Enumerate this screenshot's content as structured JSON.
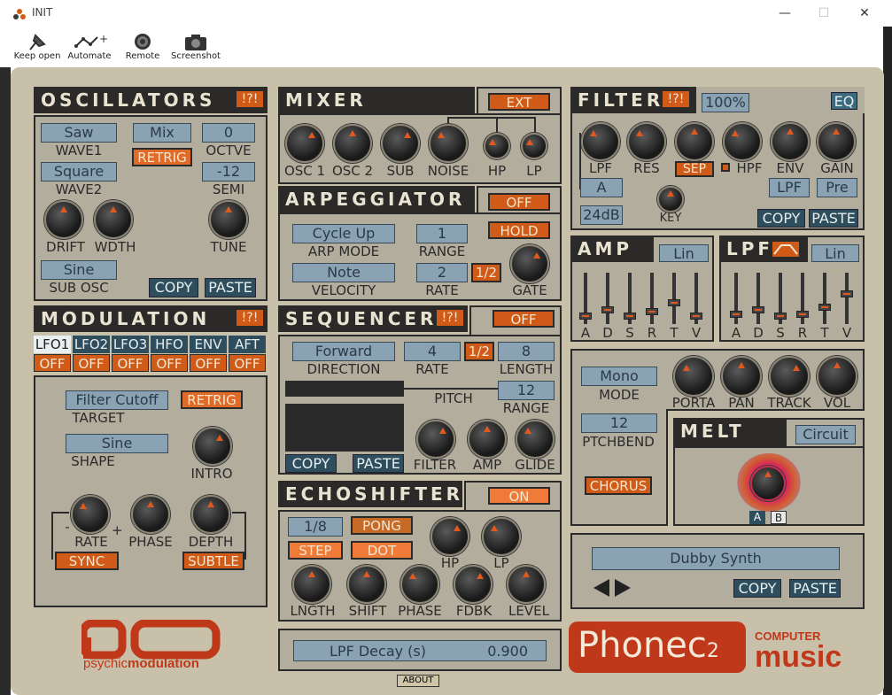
{
  "window": {
    "title": "INIT",
    "minimize": "—",
    "maximize": "☐",
    "close": "✕"
  },
  "toolbar": {
    "keep_open": "Keep open",
    "automate": "Automate",
    "remote": "Remote",
    "screenshot": "Screenshot"
  },
  "osc": {
    "title": "OSCILLATORS",
    "mark": "!?!",
    "wave1_val": "Saw",
    "wave1_lbl": "WAVE1",
    "mix": "Mix",
    "octve_val": "0",
    "octve_lbl": "OCTVE",
    "retrig": "RETRIG",
    "wave2_val": "Square",
    "wave2_lbl": "WAVE2",
    "semi_val": "-12",
    "semi_lbl": "SEMI",
    "drift": "DRIFT",
    "wdth": "WDTH",
    "tune": "TUNE",
    "sub_val": "Sine",
    "sub_lbl": "SUB OSC",
    "copy": "COPY",
    "paste": "PASTE"
  },
  "mixer": {
    "title": "MIXER",
    "ext": "EXT",
    "osc1": "OSC 1",
    "osc2": "OSC 2",
    "sub": "SUB",
    "noise": "NOISE",
    "hp": "HP",
    "lp": "LP"
  },
  "arp": {
    "title": "ARPEGGIATOR",
    "off": "OFF",
    "hold": "HOLD",
    "mode_val": "Cycle Up",
    "mode_lbl": "ARP MODE",
    "range_val": "1",
    "range_lbl": "RANGE",
    "vel_val": "Note",
    "vel_lbl": "VELOCITY",
    "rate_val": "2",
    "rate_lbl": "RATE",
    "half": "1/2",
    "gate": "GATE"
  },
  "seq": {
    "title": "SEQUENCER",
    "mark": "!?!",
    "off": "OFF",
    "dir_val": "Forward",
    "dir_lbl": "DIRECTION",
    "rate_val": "4",
    "rate_lbl": "RATE",
    "half": "1/2",
    "len_val": "8",
    "len_lbl": "LENGTH",
    "pitch": "PITCH",
    "range_val": "12",
    "range_lbl": "RANGE",
    "filter": "FILTER",
    "amp": "AMP",
    "glide": "GLIDE",
    "copy": "COPY",
    "paste": "PASTE"
  },
  "echo": {
    "title": "ECHOSHIFTER",
    "on": "ON",
    "time_val": "1/8",
    "pong": "PONG",
    "step": "STEP",
    "dot": "DOT",
    "hp": "HP",
    "lp": "LP",
    "lngth": "LNGTH",
    "shift": "SHIFT",
    "phase": "PHASE",
    "fdbk": "FDBK",
    "level": "LEVEL"
  },
  "filter": {
    "title": "FILTER",
    "mark": "!?!",
    "pct": "100%",
    "eq": "EQ",
    "lpf": "LPF",
    "res": "RES",
    "sep": "SEP",
    "hpf": "HPF",
    "env": "ENV",
    "gain": "GAIN",
    "a": "A",
    "slope": "24dB",
    "key": "KEY",
    "lpf_btn": "LPF",
    "pre": "Pre",
    "copy": "COPY",
    "paste": "PASTE"
  },
  "amp": {
    "title": "AMP",
    "curve": "Lin",
    "faders": [
      "A",
      "D",
      "S",
      "R",
      "T",
      "V"
    ],
    "levels": [
      0.1,
      0.25,
      0.1,
      0.2,
      0.4,
      0.1
    ]
  },
  "lpfenv": {
    "title": "LPF",
    "curve": "Lin",
    "faders": [
      "A",
      "D",
      "S",
      "R",
      "T",
      "V"
    ],
    "levels": [
      0.15,
      0.25,
      0.1,
      0.15,
      0.3,
      0.6
    ]
  },
  "voice": {
    "mode_val": "Mono",
    "mode_lbl": "MODE",
    "bend_val": "12",
    "bend_lbl": "PTCHBEND",
    "chorus": "CHORUS",
    "porta": "PORTA",
    "pan": "PAN",
    "track": "TRACK",
    "vol": "VOL"
  },
  "melt": {
    "title": "MELT",
    "type": "Circuit",
    "a": "A",
    "b": "B"
  },
  "preset": {
    "name": "Dubby Synth",
    "copy": "COPY",
    "paste": "PASTE"
  },
  "mod": {
    "title": "MODULATION",
    "mark": "!?!",
    "tabs": [
      "LFO1",
      "LFO2",
      "LFO3",
      "HFO",
      "ENV",
      "AFT"
    ],
    "states": [
      "OFF",
      "OFF",
      "OFF",
      "OFF",
      "OFF",
      "OFF"
    ],
    "target_val": "Filter Cutoff",
    "target_lbl": "TARGET",
    "retrig": "RETRIG",
    "shape_val": "Sine",
    "shape_lbl": "SHAPE",
    "intro": "INTRO",
    "minus": "-",
    "plus": "+",
    "rate": "RATE",
    "phase": "PHASE",
    "depth": "DEPTH",
    "sync": "SYNC",
    "subtle": "SUBTLE"
  },
  "readout": {
    "param": "LPF Decay (s)",
    "value": "0.900"
  },
  "about": "ABOUT",
  "logos": {
    "pm_text": "psychic",
    "pm_text2": "modulation",
    "phonec": "Phonec",
    "phonec_ver": "2",
    "cm1": "COMPUTER",
    "cm2": "music"
  },
  "colors": {
    "panel": "#b3ad9d",
    "accent": "#d05a18",
    "lcd": "#8aa3b4",
    "button": "#2e4e5e"
  }
}
